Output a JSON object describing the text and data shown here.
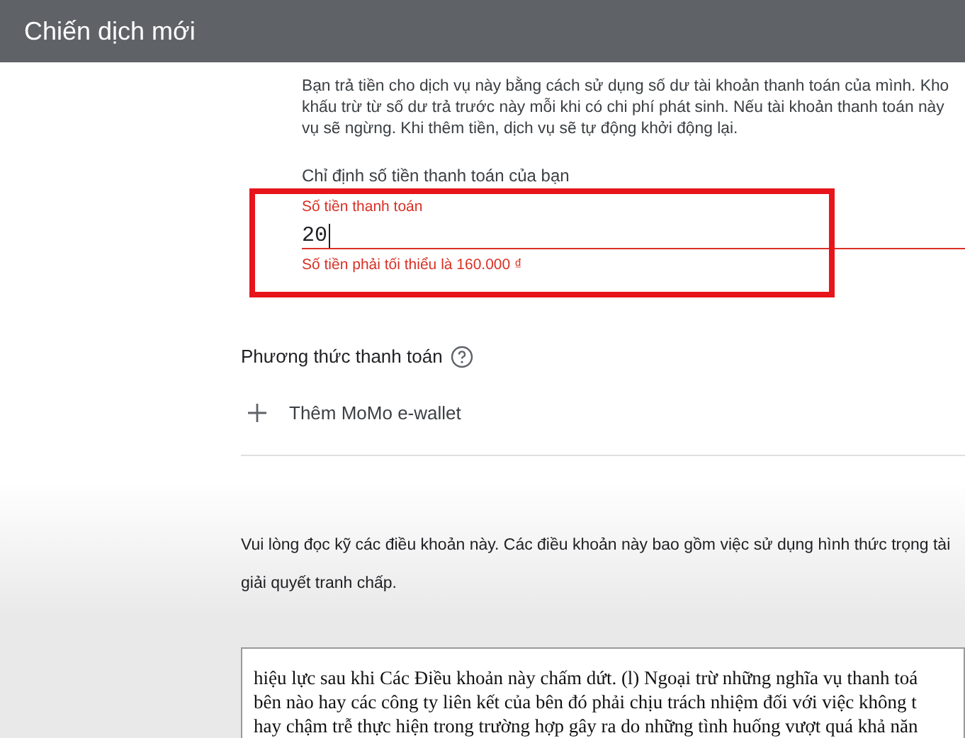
{
  "header": {
    "title": "Chiến dịch mới"
  },
  "intro_lines": [
    "Bạn trả tiền cho dịch vụ này bằng cách sử dụng số dư tài khoản thanh toán của mình. Kho",
    "khấu trừ từ số dư trả trước này mỗi khi có chi phí phát sinh. Nếu tài khoản thanh toán này",
    "vụ sẽ ngừng. Khi thêm tiền, dịch vụ sẽ tự động khởi động lại."
  ],
  "amount": {
    "heading": "Chỉ định số tiền thanh toán của bạn",
    "label": "Số tiền thanh toán",
    "value": "20",
    "error": "Số tiền phải tối thiểu là 160.000 ₫"
  },
  "payment_method": {
    "heading": "Phương thức thanh toán",
    "add_label": "Thêm MoMo e-wallet"
  },
  "terms": {
    "notice_lines": [
      "Vui lòng đọc kỹ các điều khoản này. Các điều khoản này bao gồm việc sử dụng hình thức trọng tài",
      "giải quyết tranh chấp."
    ],
    "document_lines": [
      "hiệu lực sau khi Các Điều khoản này chấm dứt. (l) Ngoại trừ những nghĩa vụ thanh toá",
      "bên nào hay các công ty liên kết của bên đó phải chịu trách nhiệm đối với việc không t",
      "hay chậm trễ thực hiện trong trường hợp gây ra do những tình huống vượt quá khả năn"
    ]
  }
}
